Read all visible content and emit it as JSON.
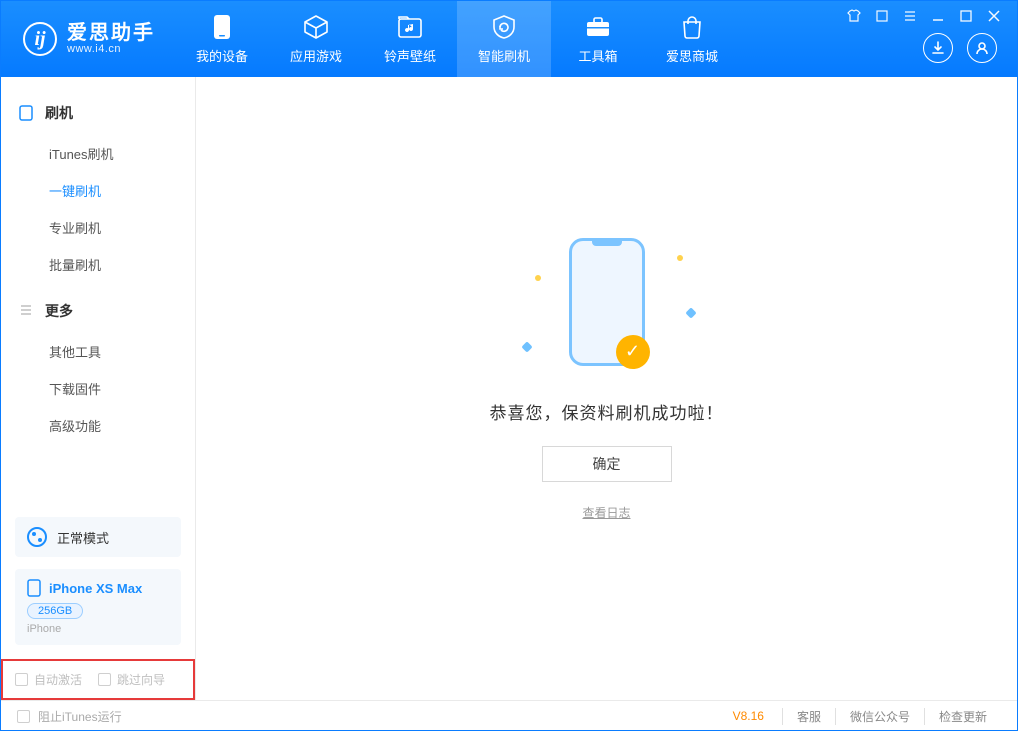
{
  "app": {
    "name_cn": "爱思助手",
    "name_en": "www.i4.cn"
  },
  "tabs": [
    {
      "label": "我的设备"
    },
    {
      "label": "应用游戏"
    },
    {
      "label": "铃声壁纸"
    },
    {
      "label": "智能刷机"
    },
    {
      "label": "工具箱"
    },
    {
      "label": "爱思商城"
    }
  ],
  "sidebar": {
    "group1": {
      "title": "刷机",
      "items": [
        "iTunes刷机",
        "一键刷机",
        "专业刷机",
        "批量刷机"
      ]
    },
    "group2": {
      "title": "更多",
      "items": [
        "其他工具",
        "下载固件",
        "高级功能"
      ]
    }
  },
  "mode": {
    "label": "正常模式"
  },
  "device": {
    "name": "iPhone XS Max",
    "capacity": "256GB",
    "type": "iPhone"
  },
  "options": {
    "auto_activate": "自动激活",
    "skip_guide": "跳过向导"
  },
  "result": {
    "message": "恭喜您，保资料刷机成功啦！",
    "ok": "确定",
    "log": "查看日志"
  },
  "footer": {
    "block_itunes": "阻止iTunes运行",
    "version": "V8.16",
    "links": [
      "客服",
      "微信公众号",
      "检查更新"
    ]
  }
}
